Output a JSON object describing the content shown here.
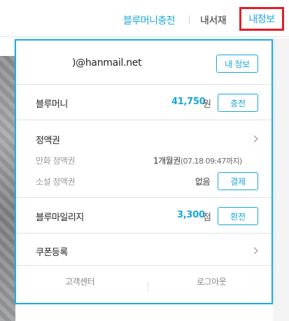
{
  "topnav": {
    "charge_label": "블루머니충전",
    "library_label": "내서재",
    "myinfo_label": "내정보"
  },
  "account": {
    "email": ")@hanmail.net",
    "my_info_button": "내 정보"
  },
  "bluemoney": {
    "label": "블루머니",
    "amount": "41,750",
    "unit": "원",
    "button": "충전"
  },
  "pass": {
    "label": "정액권",
    "comic_label": "만화 정액권",
    "comic_value": "1개월권",
    "comic_expiry": "(07.18 09:47까지)",
    "novel_label": "소설 정액권",
    "novel_value": "없음",
    "novel_button": "결제"
  },
  "mileage": {
    "label": "블루마일리지",
    "amount": "3,300",
    "unit": "점",
    "button": "환전"
  },
  "coupon": {
    "label": "쿠폰등록"
  },
  "footer": {
    "support": "고객센터",
    "logout": "로그아웃"
  },
  "colors": {
    "accent": "#1aa6d8",
    "highlight_box": "#e01f26",
    "panel_border": "#2aa8dc"
  },
  "icons": [
    "chevron-right-icon"
  ]
}
